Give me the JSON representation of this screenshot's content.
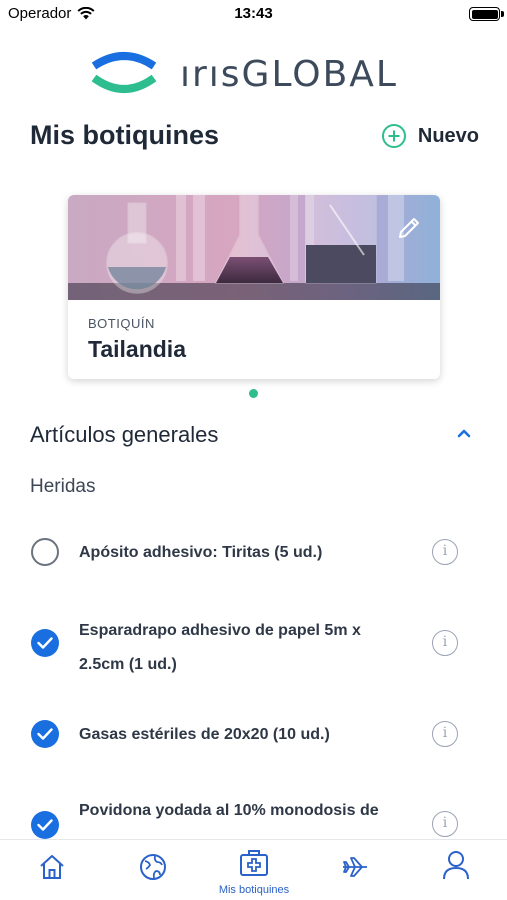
{
  "status_bar": {
    "carrier": "Operador",
    "time": "13:43"
  },
  "brand": {
    "name": "ırısGLOBAL",
    "accent": "#2dbd8f",
    "primary": "#1a6fe0"
  },
  "header": {
    "title": "Mis botiquines",
    "new_button_label": "Nuevo",
    "new_icon": "plus-circle-icon"
  },
  "kit_card": {
    "caption": "BOTIQUÍN",
    "name": "Tailandia",
    "edit_icon": "pencil-icon"
  },
  "carousel": {
    "pages": 1,
    "active": 1
  },
  "section": {
    "title": "Artículos generales",
    "expanded": true
  },
  "subsection": {
    "title": "Heridas"
  },
  "items": [
    {
      "label": "Apósito adhesivo: Tiritas (5 ud.)",
      "checked": false
    },
    {
      "label": "Esparadrapo adhesivo de papel 5m x 2.5cm (1 ud.)",
      "checked": true
    },
    {
      "label": "Gasas estériles de 20x20 (10 ud.)",
      "checked": true
    },
    {
      "label": "Povidona yodada al 10% monodosis de",
      "checked": true
    }
  ],
  "tab_bar": {
    "tabs": [
      {
        "icon": "home-icon",
        "label": ""
      },
      {
        "icon": "globe-icon",
        "label": ""
      },
      {
        "icon": "first-aid-kit-icon",
        "label": "Mis botiquines",
        "active": true
      },
      {
        "icon": "airplane-icon",
        "label": ""
      },
      {
        "icon": "user-icon",
        "label": ""
      }
    ]
  }
}
